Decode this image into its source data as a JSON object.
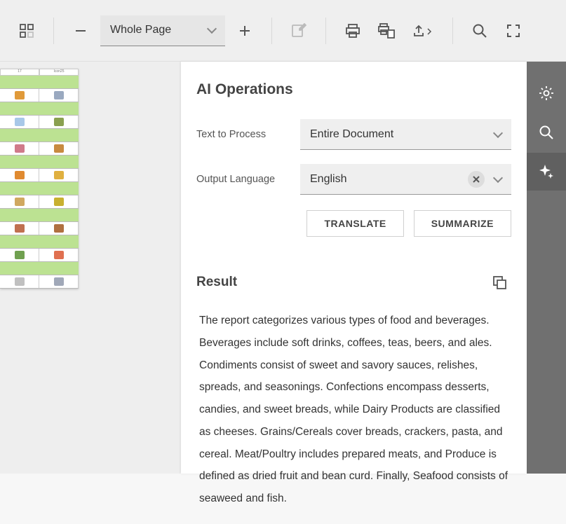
{
  "toolbar": {
    "zoom_select": "Whole Page"
  },
  "panel": {
    "title": "AI Operations",
    "text_to_process_label": "Text to Process",
    "text_to_process_value": "Entire Document",
    "output_language_label": "Output Language",
    "output_language_value": "English",
    "translate_label": "TRANSLATE",
    "summarize_label": "SUMMARIZE",
    "result_label": "Result",
    "result_text": "The report categorizes various types of food and beverages. Beverages include soft drinks, coffees, teas, beers, and ales. Condiments consist of sweet and savory sauces, relishes, spreads, and seasonings. Confections encompass desserts, candies, and sweet breads, while Dairy Products are classified as cheeses. Grains/Cereals cover breads, crackers, pasta, and cereal. Meat/Poultry includes prepared meats, and Produce is defined as dried fruit and bean curd. Finally, Seafood consists of seaweed and fish."
  },
  "doc": {
    "header_cells": [
      "17",
      "Icon25"
    ]
  },
  "thumb_icons": [
    [
      "#e09a3a",
      "#9aa9c0"
    ],
    [
      "#a8c8e8",
      "#8aa050"
    ],
    [
      "#d07a8a",
      "#c88a40"
    ],
    [
      "#e08a30",
      "#e0b040"
    ],
    [
      "#d0a860",
      "#c8b030"
    ],
    [
      "#c07050",
      "#b07040"
    ],
    [
      "#70a050",
      "#e07050"
    ],
    [
      "#c0c0c0",
      "#a0a8b8"
    ]
  ]
}
